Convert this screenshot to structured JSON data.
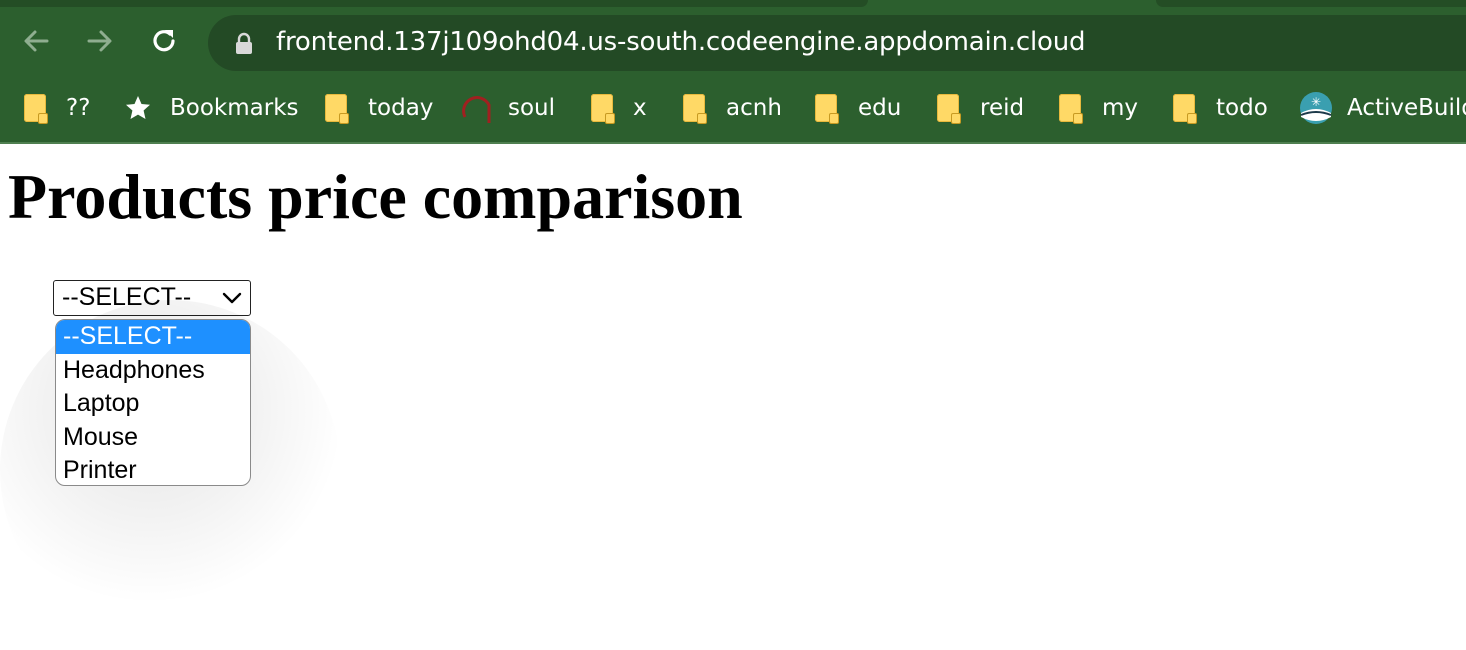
{
  "browser": {
    "url": "frontend.137j109ohd04.us-south.codeengine.appdomain.cloud",
    "colors": {
      "frame": "#2c5f2e",
      "omnibox": "#234a25"
    }
  },
  "bookmarks": [
    {
      "label": "??",
      "icon": "folder-icon"
    },
    {
      "label": "Bookmarks",
      "icon": "star-icon"
    },
    {
      "label": "today",
      "icon": "folder-icon"
    },
    {
      "label": "soul",
      "icon": "arc-icon"
    },
    {
      "label": "x",
      "icon": "folder-icon"
    },
    {
      "label": "acnh",
      "icon": "folder-icon"
    },
    {
      "label": "edu",
      "icon": "folder-icon"
    },
    {
      "label": "reid",
      "icon": "folder-icon"
    },
    {
      "label": "my",
      "icon": "folder-icon"
    },
    {
      "label": "todo",
      "icon": "folder-icon"
    },
    {
      "label": "ActiveBuild",
      "icon": "activebuild-icon"
    }
  ],
  "page": {
    "title": "Products price comparison",
    "select": {
      "value": "--SELECT--",
      "options": [
        "--SELECT--",
        "Headphones",
        "Laptop",
        "Mouse",
        "Printer"
      ],
      "highlighted_option": "--SELECT--",
      "highlight_color": "#1e90ff"
    }
  }
}
